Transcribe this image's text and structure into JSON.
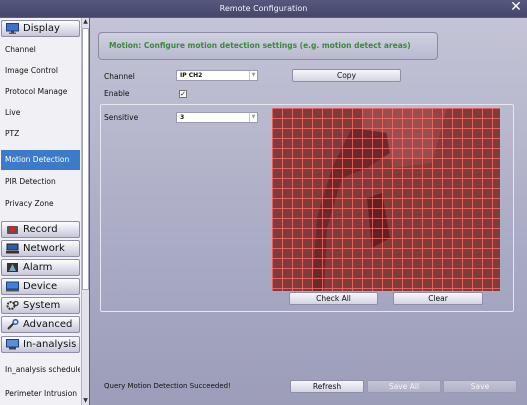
{
  "window": {
    "title": "Remote Configuration"
  },
  "sidebar": {
    "categories": [
      {
        "label": "Display",
        "icon": "monitor-icon"
      },
      {
        "label": "Record",
        "icon": "record-icon"
      },
      {
        "label": "Network",
        "icon": "network-icon"
      },
      {
        "label": "Alarm",
        "icon": "alarm-icon"
      },
      {
        "label": "Device",
        "icon": "device-icon"
      },
      {
        "label": "System",
        "icon": "gear-icon"
      },
      {
        "label": "Advanced",
        "icon": "wrench-icon"
      },
      {
        "label": "In-analysis",
        "icon": "analysis-icon"
      }
    ],
    "display_items": [
      "Channel",
      "Image Control",
      "Protocol Manage",
      "Live",
      "PTZ",
      "Motion Detection",
      "PIR Detection",
      "Privacy Zone"
    ],
    "analysis_items": [
      "In_analysis schedule",
      "Perimeter Intrusion"
    ],
    "active_item": "Motion Detection"
  },
  "main": {
    "banner": "Motion: Configure motion detection settings (e.g. motion detect areas)",
    "channel_label": "Channel",
    "channel_value": "IP CH2",
    "copy_label": "Copy",
    "enable_label": "Enable",
    "enable_checked": "✓",
    "sensitive_label": "Sensitive",
    "sensitive_value": "3",
    "check_all_label": "Check All",
    "clear_label": "Clear",
    "status": "Query Motion Detection Succeeded!",
    "refresh_label": "Refresh",
    "save_all_label": "Save All",
    "save_label": "Save"
  }
}
